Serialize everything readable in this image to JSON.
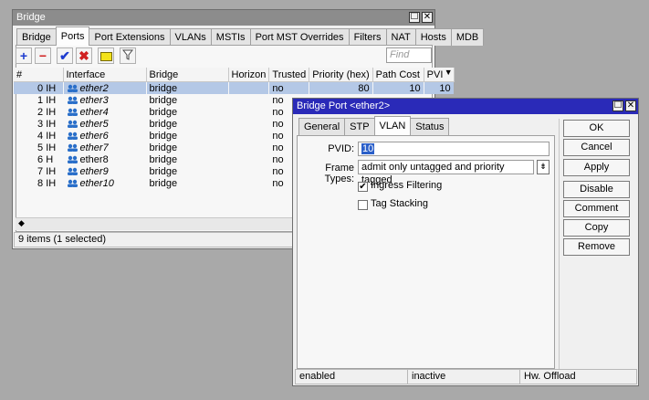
{
  "bridge_window": {
    "title": "Bridge",
    "tabs": [
      "Bridge",
      "Ports",
      "Port Extensions",
      "VLANs",
      "MSTIs",
      "Port MST Overrides",
      "Filters",
      "NAT",
      "Hosts",
      "MDB"
    ],
    "active_tab": "Ports",
    "find_placeholder": "Find",
    "columns": [
      "#",
      "Interface",
      "Bridge",
      "Horizon",
      "Trusted",
      "Priority (hex)",
      "Path Cost",
      "PVI"
    ],
    "rows": [
      {
        "num": "0",
        "flags": "IH",
        "interface": "ether2",
        "bridge": "bridge",
        "horizon": "",
        "trusted": "no",
        "priority": "80",
        "path_cost": "10",
        "pvid": "10"
      },
      {
        "num": "1",
        "flags": "IH",
        "interface": "ether3",
        "bridge": "bridge",
        "horizon": "",
        "trusted": "no",
        "priority": "",
        "path_cost": "",
        "pvid": ""
      },
      {
        "num": "2",
        "flags": "IH",
        "interface": "ether4",
        "bridge": "bridge",
        "horizon": "",
        "trusted": "no",
        "priority": "",
        "path_cost": "",
        "pvid": ""
      },
      {
        "num": "3",
        "flags": "IH",
        "interface": "ether5",
        "bridge": "bridge",
        "horizon": "",
        "trusted": "no",
        "priority": "",
        "path_cost": "",
        "pvid": ""
      },
      {
        "num": "4",
        "flags": "IH",
        "interface": "ether6",
        "bridge": "bridge",
        "horizon": "",
        "trusted": "no",
        "priority": "",
        "path_cost": "",
        "pvid": ""
      },
      {
        "num": "5",
        "flags": "IH",
        "interface": "ether7",
        "bridge": "bridge",
        "horizon": "",
        "trusted": "no",
        "priority": "",
        "path_cost": "",
        "pvid": ""
      },
      {
        "num": "6",
        "flags": "H",
        "interface": "ether8",
        "bridge": "bridge",
        "horizon": "",
        "trusted": "no",
        "priority": "",
        "path_cost": "",
        "pvid": ""
      },
      {
        "num": "7",
        "flags": "IH",
        "interface": "ether9",
        "bridge": "bridge",
        "horizon": "",
        "trusted": "no",
        "priority": "",
        "path_cost": "",
        "pvid": ""
      },
      {
        "num": "8",
        "flags": "IH",
        "interface": "ether10",
        "bridge": "bridge",
        "horizon": "",
        "trusted": "no",
        "priority": "",
        "path_cost": "",
        "pvid": ""
      }
    ],
    "status": "9 items (1 selected)"
  },
  "port_window": {
    "title": "Bridge Port <ether2>",
    "tabs": [
      "General",
      "STP",
      "VLAN",
      "Status"
    ],
    "active_tab": "VLAN",
    "pvid_label": "PVID:",
    "pvid_value": "10",
    "frame_types_label": "Frame Types:",
    "frame_types_value": "admit only untagged and priority tagged",
    "ingress_filtering_label": "Ingress Filtering",
    "ingress_filtering_checked": true,
    "tag_stacking_label": "Tag Stacking",
    "tag_stacking_checked": false,
    "buttons": [
      "OK",
      "Cancel",
      "Apply",
      "Disable",
      "Comment",
      "Copy",
      "Remove"
    ],
    "status": [
      "enabled",
      "inactive",
      "Hw. Offload"
    ]
  },
  "colors": {
    "active_title": "#2a2ab8",
    "inactive_title": "#8c8c8c",
    "selection": "#b4c8e6",
    "interface_icon": "#2a6fc9"
  },
  "icons": [
    "add-icon",
    "remove-icon",
    "enable-icon",
    "disable-icon",
    "comment-icon",
    "filter-icon",
    "interface-icon"
  ]
}
